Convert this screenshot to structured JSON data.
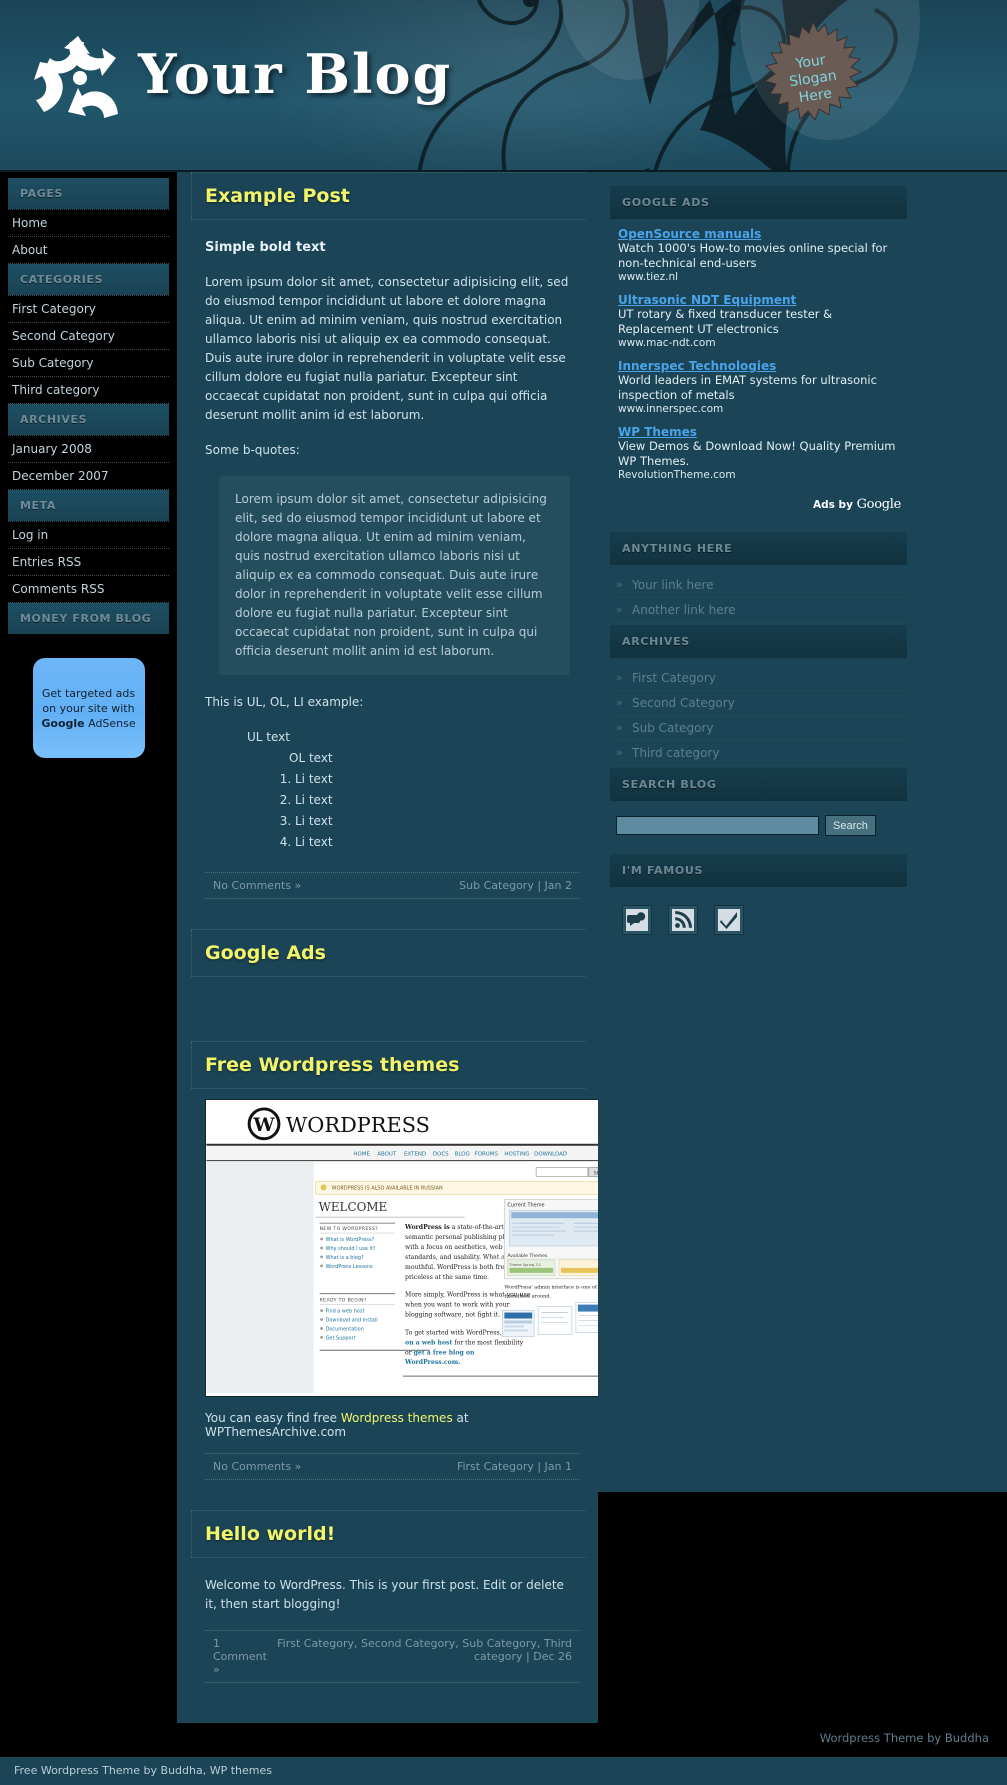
{
  "header": {
    "title": "Your Blog",
    "slogan_line1": "Your",
    "slogan_line2": "Slogan",
    "slogan_line3": "Here"
  },
  "left_sidebar": {
    "sections": [
      {
        "title": "PAGES",
        "items": [
          "Home",
          "About"
        ]
      },
      {
        "title": "CATEGORIES",
        "items": [
          "First Category",
          "Second Category",
          "Sub Category",
          "Third category"
        ]
      },
      {
        "title": "ARCHIVES",
        "items": [
          "January 2008",
          "December 2007"
        ]
      },
      {
        "title": "META",
        "items": [
          "Log in",
          "Entries RSS",
          "Comments RSS"
        ]
      },
      {
        "title": "MONEY FROM BLOG",
        "items": []
      }
    ],
    "adsense": {
      "line1": "Get targeted ads",
      "line2": "on your site with",
      "brand": "Google",
      "line3": " AdSense"
    }
  },
  "posts": [
    {
      "title": "Example Post",
      "bold_head": "Simple bold text",
      "paragraph": "Lorem ipsum dolor sit amet, consectetur adipisicing elit, sed do eiusmod tempor incididunt ut labore et dolore magna aliqua. Ut enim ad minim veniam, quis nostrud exercitation ullamco laboris nisi ut aliquip ex ea commodo consequat. Duis aute irure dolor in reprehenderit in voluptate velit esse cillum dolore eu fugiat nulla pariatur. Excepteur sint occaecat cupidatat non proident, sunt in culpa qui officia deserunt mollit anim id est laborum.",
      "quote_intro": "Some b-quotes:",
      "quote": "Lorem ipsum dolor sit amet, consectetur adipisicing elit, sed do eiusmod tempor incididunt ut labore et dolore magna aliqua. Ut enim ad minim veniam, quis nostrud exercitation ullamco laboris nisi ut aliquip ex ea commodo consequat. Duis aute irure dolor in reprehenderit in voluptate velit esse cillum dolore eu fugiat nulla pariatur. Excepteur sint occaecat cupidatat non proident, sunt in culpa qui officia deserunt mollit anim id est laborum.",
      "list_intro": "This is UL, OL, LI example:",
      "ul_text": "UL text",
      "ol_text": "OL text",
      "li_items": [
        "Li text",
        "Li text",
        "Li text",
        "Li text"
      ],
      "comments": "No Comments »",
      "meta": "Sub Category | Jan 2"
    },
    {
      "title": "Google Ads"
    },
    {
      "title": "Free Wordpress themes",
      "caption_pre": "You can easy find free ",
      "caption_link": "Wordpress themes",
      "caption_post": " at WPThemesArchive.com",
      "comments": "No Comments »",
      "meta": "First Category | Jan 1"
    },
    {
      "title": "Hello world!",
      "body": "Welcome to WordPress. This is your first post. Edit or delete it, then start blogging!",
      "comments": "1 Comment »",
      "meta": "First Category, Second Category, Sub Category, Third category | Dec 26"
    }
  ],
  "wp_screenshot": {
    "brand": "WordPress",
    "nav": [
      "HOME",
      "ABOUT",
      "EXTEND",
      "DOCS",
      "BLOG",
      "FORUMS",
      "HOSTING",
      "DOWNLOAD"
    ],
    "search_label": "SEARCH",
    "notice": "WORDPRESS IS ALSO AVAILABLE IN RUSSIAN",
    "welcome": "WELCOME",
    "new_head": "NEW TO WORDPRESS?",
    "new_items": [
      "What is WordPress?",
      "Why should I use it?",
      "What is a blog?",
      "WordPress Lessons"
    ],
    "ready_head": "READY TO BEGIN?",
    "ready_items": [
      "Find a web host",
      "Download and Install",
      "Documentation",
      "Get Support"
    ],
    "p1_bold": "WordPress is",
    "p1": " a state-of-the-art semantic personal publishing platform with a focus on aesthetics, web standards, and usability. What a mouthful. WordPress is both free and priceless at the same time.",
    "p2": "More simply, WordPress is what you use when you want to work with your blogging software, not fight it.",
    "p3_pre": "To get started with WordPress, ",
    "p3_b1": "set it up on a web host",
    "p3_mid": " for the most flexibility or ",
    "p3_b2": "get a free blog on WordPress.com",
    "p3_end": ".",
    "right_head": "Current Theme",
    "right_avail": "Available Themes",
    "right_note": "WordPress' admin interface is one of the friendliest around."
  },
  "right_sidebar": {
    "google_ads": {
      "title": "GOOGLE ADS",
      "ads": [
        {
          "title": "OpenSource manuals",
          "desc": "Watch 1000's How-to movies online special for non-technical end-users",
          "url": "www.tiez.nl"
        },
        {
          "title": "Ultrasonic NDT Equipment",
          "desc": "UT rotary & fixed transducer tester & Replacement UT electronics",
          "url": "www.mac-ndt.com"
        },
        {
          "title": "Innerspec Technologies",
          "desc": "World leaders in EMAT systems for ultrasonic inspection of metals",
          "url": "www.innerspec.com"
        },
        {
          "title": "WP Themes",
          "desc": "View Demos & Download Now! Quality Premium WP Themes.",
          "url": "RevolutionTheme.com"
        }
      ],
      "ads_by": "Ads by ",
      "ads_by_brand": "Google"
    },
    "anything_here": {
      "title": "ANYTHING HERE",
      "items": [
        "Your link here",
        "Another link here"
      ]
    },
    "archives": {
      "title": "ARCHIVES",
      "items": [
        "First Category",
        "Second Category",
        "Sub Category",
        "Third category"
      ]
    },
    "search": {
      "title": "SEARCH BLOG",
      "value": "",
      "placeholder": "",
      "button": "Search"
    },
    "famous": {
      "title": "I'M FAMOUS",
      "icons": [
        "technorati-icon",
        "rss-feed-icon",
        "checkmark-icon"
      ]
    }
  },
  "footer": {
    "credit": "Wordpress Theme by Buddha",
    "bottom": "Free Wordpress Theme by Buddha, WP themes"
  }
}
